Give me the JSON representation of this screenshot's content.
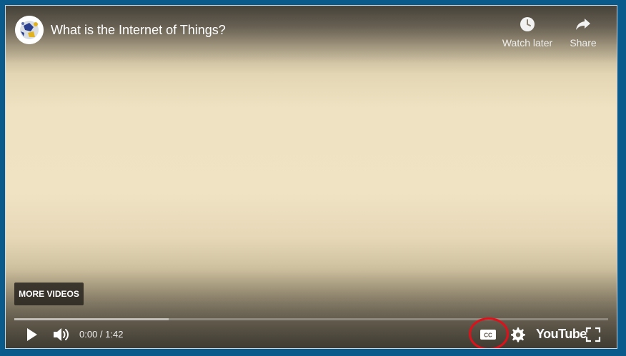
{
  "video": {
    "title": "What is the Internet of Things?"
  },
  "top_actions": {
    "watch_later": "Watch later",
    "share": "Share"
  },
  "overlay": {
    "more_videos": "MORE VIDEOS"
  },
  "controls": {
    "time": "0:00 / 1:42",
    "progress_loaded_fraction": 0.26,
    "progress_played_fraction": 0.0,
    "logo": "YouTube",
    "icons": [
      "play-icon",
      "volume-icon",
      "closed-captions-icon",
      "gear-icon",
      "fullscreen-icon",
      "clock-icon",
      "share-arrow-icon"
    ]
  },
  "colors": {
    "frame": "#0b5a8c",
    "highlight": "#e0101a",
    "progress_played": "#ff0000"
  }
}
